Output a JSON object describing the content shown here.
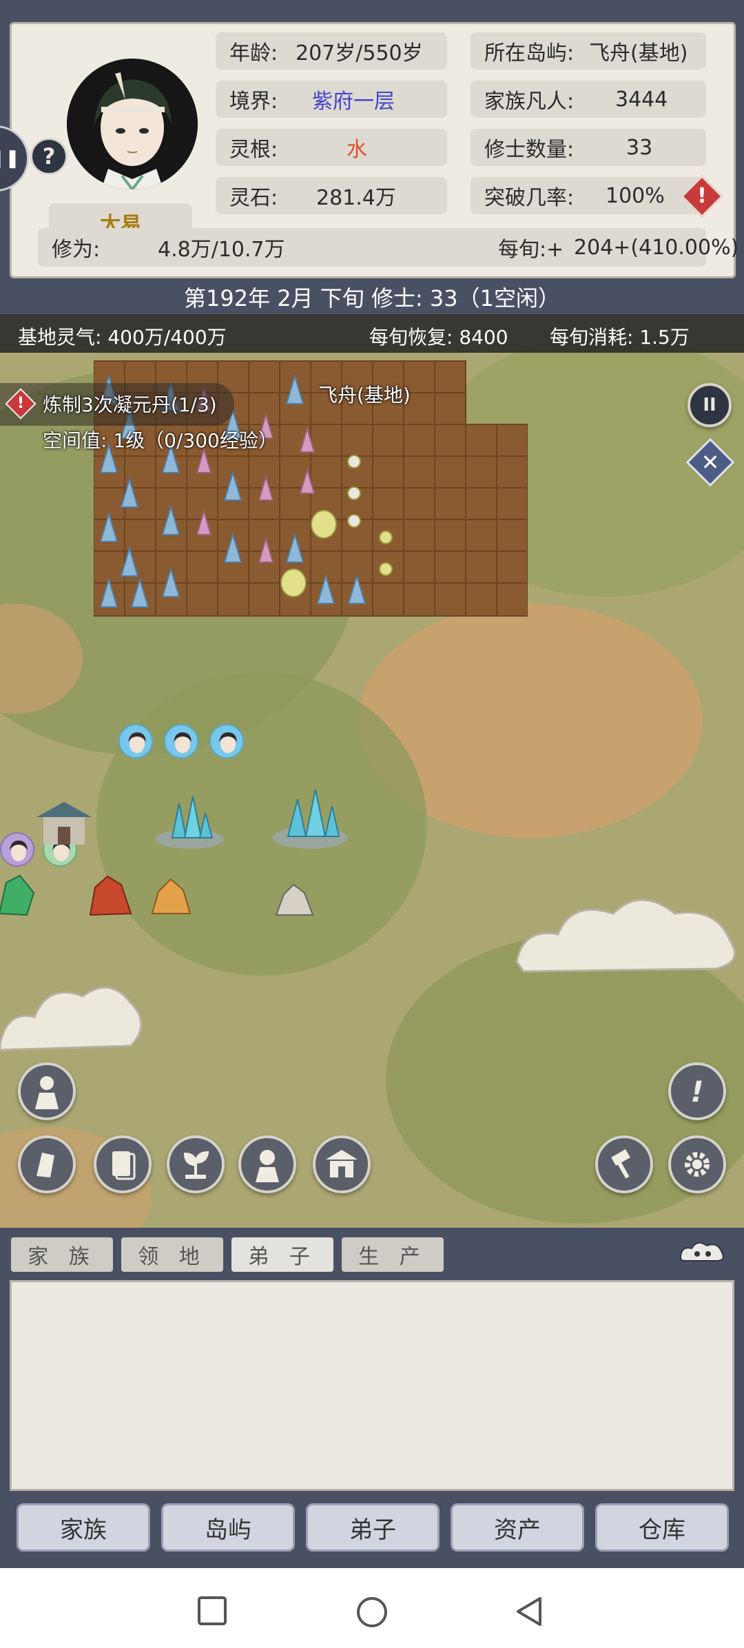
{
  "profile": {
    "name": "太易",
    "help": "?",
    "age_label": "年龄:",
    "age_value": "207岁/550岁",
    "realm_label": "境界:",
    "realm_value": "紫府一层",
    "root_label": "灵根:",
    "root_value": "水",
    "stones_label": "灵石:",
    "stones_value": "281.4万",
    "island_label": "所在岛屿:",
    "island_value": "飞舟(基地)",
    "mortals_label": "家族凡人:",
    "mortals_value": "3444",
    "cultivators_label": "修士数量:",
    "cultivators_value": "33",
    "breakthrough_label": "突破几率:",
    "breakthrough_value": "100%",
    "cultivation_label": "修为:",
    "cultivation_value": "4.8万/10.7万",
    "per_period_label": "每旬:+",
    "per_period_value": "204+(410.00%)",
    "warn": "!"
  },
  "date_bar": "第192年 2月 下旬   修士: 33（1空闲）",
  "resources": {
    "qi": "基地灵气: 400万/400万",
    "recover": "每旬恢复: 8400",
    "consume": "每旬消耗: 1.5万"
  },
  "map": {
    "location": "飞舟(基地)",
    "task": "炼制3次凝元丹(1/3)",
    "space": "空间值: 1级（0/300经验）",
    "task_warn": "!"
  },
  "map_buttons": {
    "pause": "II",
    "close": "✕",
    "alert": "!",
    "icons": [
      "character-icon",
      "scroll-icon",
      "card-icon",
      "sprout-icon",
      "avatar-icon",
      "palace-icon",
      "hammer-icon",
      "gear-icon"
    ]
  },
  "subtabs": [
    "家 族",
    "领 地",
    "弟 子",
    "生 产"
  ],
  "active_subtab": 2,
  "nav": [
    "家族",
    "岛屿",
    "弟子",
    "资产",
    "仓库"
  ],
  "colors": {
    "panel": "#4a5064",
    "card": "#efebe2",
    "map": "#aaa772",
    "realm": "#4444cc",
    "root": "#e0502a"
  }
}
